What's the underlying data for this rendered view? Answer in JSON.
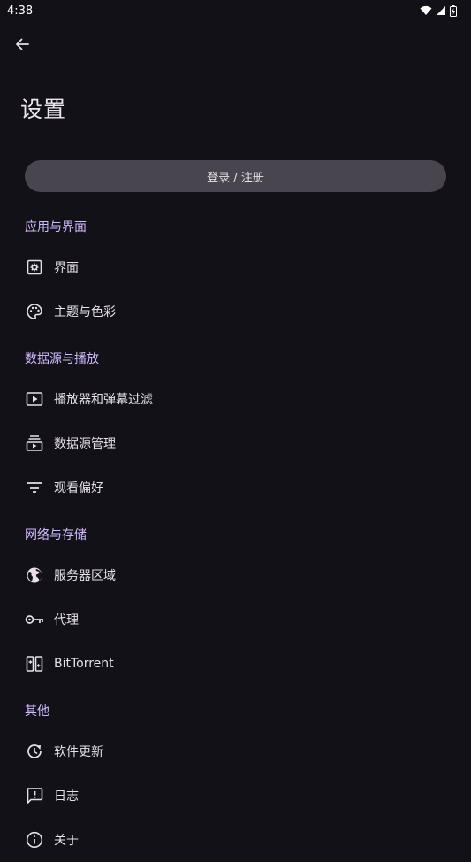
{
  "status": {
    "time": "4:38"
  },
  "page": {
    "title": "设置"
  },
  "account": {
    "login_label": "登录 / 注册"
  },
  "sections": {
    "app": {
      "header": "应用与界面",
      "items": [
        "界面",
        "主题与色彩"
      ]
    },
    "source": {
      "header": "数据源与播放",
      "items": [
        "播放器和弹幕过滤",
        "数据源管理",
        "观看偏好"
      ]
    },
    "network": {
      "header": "网络与存储",
      "items": [
        "服务器区域",
        "代理",
        "BitTorrent"
      ]
    },
    "other": {
      "header": "其他",
      "items": [
        "软件更新",
        "日志",
        "关于"
      ]
    }
  },
  "icons": {
    "back": "arrow-back-icon",
    "interface": "settings-box-icon",
    "theme": "palette-icon",
    "player": "play-box-icon",
    "sources": "subscriptions-icon",
    "preferences": "filter-list-icon",
    "region": "globe-icon",
    "proxy": "key-icon",
    "bittorrent": "transfer-icon",
    "update": "update-icon",
    "log": "feedback-icon",
    "about": "info-icon"
  },
  "colors": {
    "background": "#131118",
    "accent": "#cfbcff",
    "button": "#49454f"
  }
}
